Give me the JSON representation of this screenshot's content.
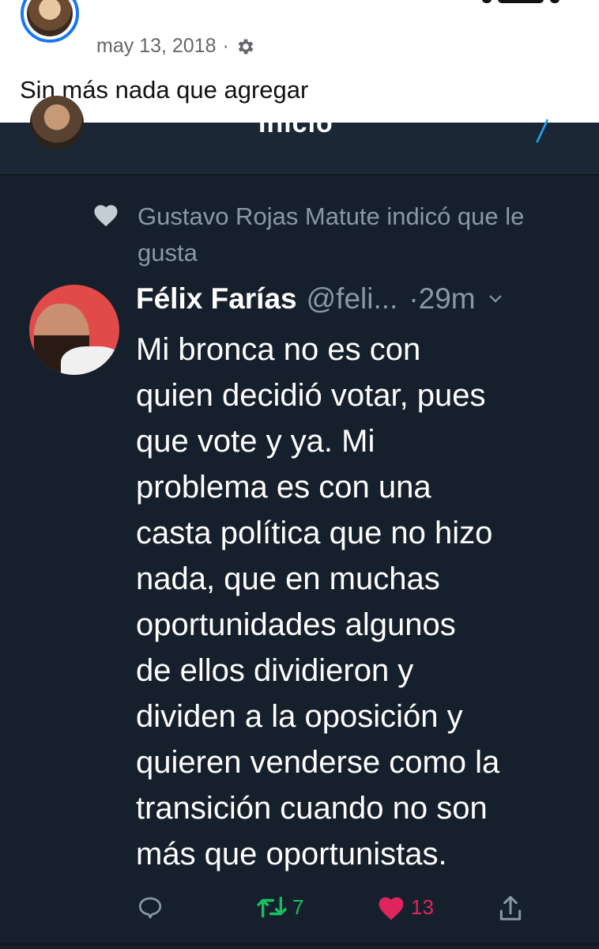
{
  "fb_post": {
    "date": "may 13, 2018",
    "separator": "·",
    "caption": "Sin más nada que agregar",
    "icons": {
      "privacy": "gear-icon"
    }
  },
  "tweet_screenshot": {
    "top_bar": {
      "title": "Inicio"
    },
    "liked_by": "Gustavo Rojas Matute indicó que le gusta",
    "author_name": "Félix Farías",
    "author_handle": "@feli...",
    "time": "·29m",
    "body": "Mi bronca no es con\nquien decidió votar, pues\nque vote y ya. Mi\nproblema es con una\ncasta política que no hizo\nnada, que en muchas\noportunidades algunos\nde ellos dividieron y\ndividen a la oposición y\nquieren venderse como la\ntransición cuando no son\nmás que oportunistas.",
    "actions": {
      "reply_icon": "reply-icon",
      "retweet_icon": "retweet-icon",
      "retweet_count": "7",
      "like_icon": "heart-icon",
      "like_count": "13",
      "share_icon": "share-icon"
    },
    "colors": {
      "background": "#16202c",
      "muted_text": "#8899a6",
      "retweet_green": "#17bf63",
      "like_red": "#e0245e"
    }
  }
}
